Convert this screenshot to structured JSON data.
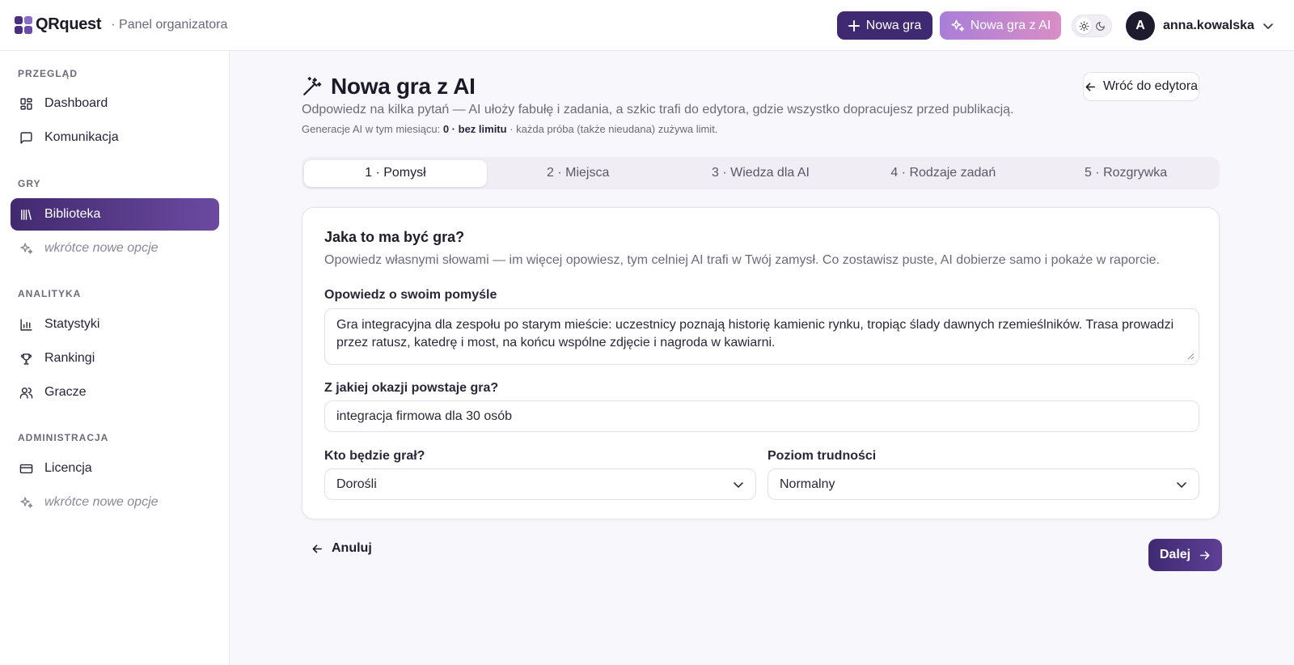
{
  "header": {
    "brand": "QRquest",
    "subtitle": "· Panel organizatora",
    "new_game": "Nowa gra",
    "new_game_ai": "Nowa gra z AI",
    "user_initial": "A",
    "username": "anna.kowalska"
  },
  "sidebar": {
    "sections": [
      {
        "title": "PRZEGLĄD",
        "items": [
          {
            "label": "Dashboard",
            "icon": "dashboard-icon"
          },
          {
            "label": "Komunikacja",
            "icon": "chat-icon"
          }
        ]
      },
      {
        "title": "GRY",
        "items": [
          {
            "label": "Biblioteka",
            "icon": "library-icon",
            "active": true
          },
          {
            "label": "wkrótce nowe opcje",
            "icon": "sparkles-icon",
            "soon": true
          }
        ]
      },
      {
        "title": "ANALITYKA",
        "items": [
          {
            "label": "Statystyki",
            "icon": "bar-chart-icon"
          },
          {
            "label": "Rankingi",
            "icon": "trophy-icon"
          },
          {
            "label": "Gracze",
            "icon": "users-icon"
          }
        ]
      },
      {
        "title": "ADMINISTRACJA",
        "items": [
          {
            "label": "Licencja",
            "icon": "credit-card-icon"
          },
          {
            "label": "wkrótce nowe opcje",
            "icon": "sparkles-icon",
            "soon": true
          }
        ]
      }
    ]
  },
  "page": {
    "title": "Nowa gra z AI",
    "subtitle": "Odpowiedz na kilka pytań — AI ułoży fabułę i zadania, a szkic trafi do edytora, gdzie wszystko dopracujesz przed publikacją.",
    "note_prefix": "Generacje AI w tym miesiącu: ",
    "note_count": "0 · bez limitu",
    "note_suffix": " · każda próba (także nieudana) zużywa limit.",
    "back_label": "Wróć do edytora"
  },
  "steps": [
    "1 · Pomysł",
    "2 · Miejsca",
    "3 · Wiedza dla AI",
    "4 · Rodzaje zadań",
    "5 · Rozgrywka"
  ],
  "active_step": 0,
  "form": {
    "title": "Jaka to ma być gra?",
    "subtitle": "Opowiedz własnymi słowami — im więcej opowiesz, tym celniej AI trafi w Twój zamysł. Co zostawisz puste, AI dobierze samo i pokaże w raporcie.",
    "idea_label": "Opowiedz o swoim pomyśle",
    "idea_value": "Gra integracyjna dla zespołu po starym mieście: uczestnicy poznają historię kamienic rynku, tropiąc ślady dawnych rzemieślników. Trasa prowadzi przez ratusz, katedrę i most, na końcu wspólne zdjęcie i nagroda w kawiarni.",
    "occasion_label": "Z jakiej okazji powstaje gra?",
    "occasion_value": "integracja firmowa dla 30 osób",
    "audience_label": "Kto będzie grał?",
    "audience_value": "Dorośli",
    "difficulty_label": "Poziom trudności",
    "difficulty_value": "Normalny"
  },
  "footer": {
    "cancel": "Anuluj",
    "next": "Dalej"
  },
  "colors": {
    "primary": "#3f2a72",
    "ai_gradient_start": "#a97ed8",
    "ai_gradient_end": "#d98ec5"
  }
}
